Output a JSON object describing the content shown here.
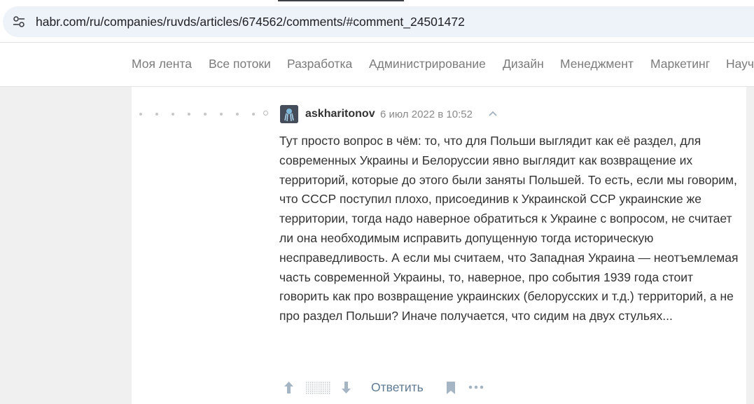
{
  "browser": {
    "url": "habr.com/ru/companies/ruvds/articles/674562/comments/#comment_24501472",
    "site_icon": "site-settings-icon"
  },
  "nav": {
    "items": [
      "Моя лента",
      "Все потоки",
      "Разработка",
      "Администрирование",
      "Дизайн",
      "Менеджмент",
      "Маркетинг",
      "Научпоп"
    ]
  },
  "comment": {
    "username": "askharitonov",
    "time": "6 июл 2022 в 10:52",
    "body": "Тут просто вопрос в чём: то, что для Польши выглядит как её раздел, для современных Украины и Белоруссии явно выглядит как возвращение их территорий, которые до этого были заняты Польшей. То есть, если мы говорим, что СССР поступил плохо, присоединив к Украинской ССР украинские же территории, тогда надо наверное обратиться к Украине с вопросом, не считает ли она необходимым исправить допущенную тогда историческую несправедливость. А если мы считаем, что Западная Украина — неотъемлемая часть современной Украины, то, наверное, про события 1939 года стоит говорить как про возвращение украинских (белорусских и т.д.) территорий, а не про раздел Польши? Иначе получается, что сидим на двух стульях...",
    "reply_label": "Ответить",
    "collapse_icon": "chevron-up-icon"
  },
  "actions": {
    "upvote_icon": "arrow-up-icon",
    "downvote_icon": "arrow-down-icon",
    "bookmark_icon": "bookmark-icon",
    "more_icon": "more-horizontal-icon"
  },
  "colors": {
    "link": "#5e7a93",
    "muted": "#8a8a8a",
    "text": "#333333"
  }
}
